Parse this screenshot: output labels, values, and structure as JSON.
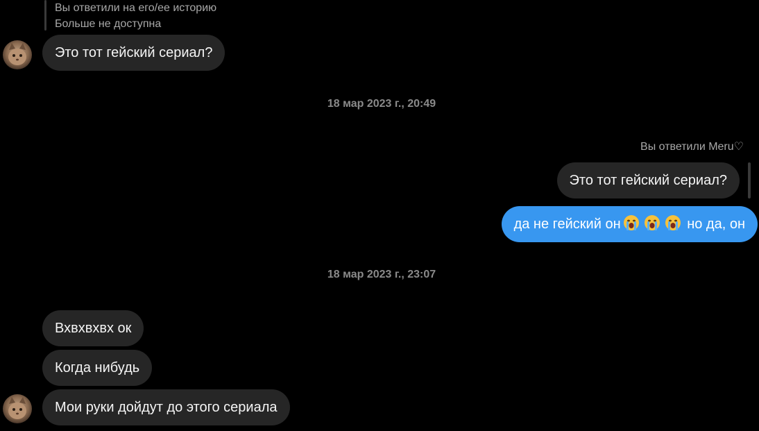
{
  "story_reply": {
    "line1": "Вы ответили на его/ее историю",
    "line2": "Больше не доступна"
  },
  "messages": {
    "m1": "Это тот гейский сериал?",
    "timestamp1": "18 мар 2023 г., 20:49",
    "reply_label": "Вы ответили Meru♡",
    "quoted": "Это тот гейский сериал?",
    "m2_part1": "да не гейский он",
    "m2_part2": "но да, он",
    "m2_emojis": [
      "crying-face-emoji",
      "crying-face-emoji",
      "crying-face-emoji"
    ],
    "timestamp2": "18 мар 2023 г., 23:07",
    "m3": "Вхвхвхвх ок",
    "m4": "Когда нибудь",
    "m5": "Мои руки дойдут до этого сериала"
  },
  "colors": {
    "background": "#000000",
    "incoming_bubble": "#262626",
    "outgoing_bubble": "#3897f0",
    "timestamp": "#8a8a8a",
    "muted_text": "#a8a8a8"
  },
  "icons": {
    "avatar": "cat-avatar"
  }
}
